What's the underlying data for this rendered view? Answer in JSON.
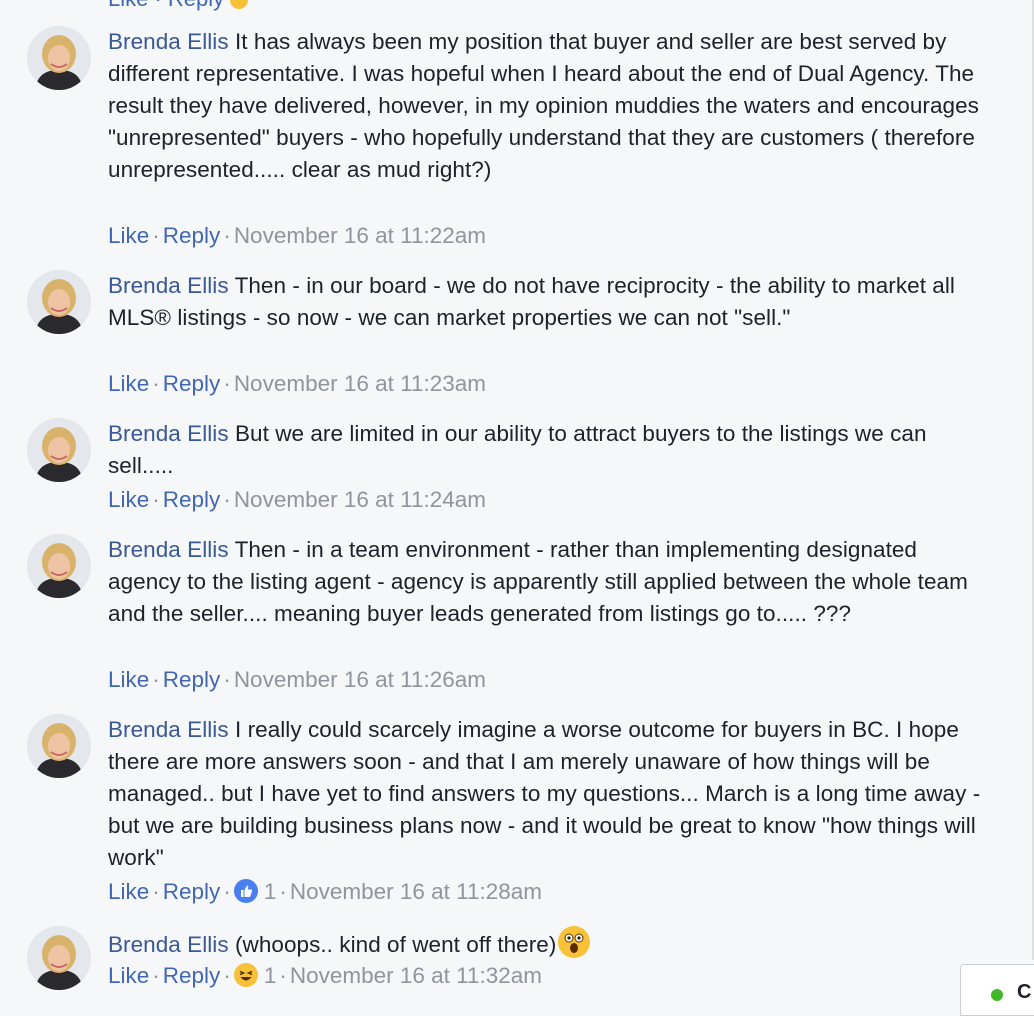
{
  "top_fragment": {
    "text": "Like · Reply"
  },
  "colors": {
    "link": "#4267b2",
    "author": "#385898",
    "meta": "#90949c",
    "text": "#1d2129",
    "background": "#f6f7f9",
    "online": "#42b72a"
  },
  "action_labels": {
    "like": "Like",
    "reply": "Reply",
    "separator": "·"
  },
  "comments": [
    {
      "author": "Brenda Ellis",
      "text": "It has always been my position that buyer and seller are best served by different representative. I was hopeful when I heard about the end of Dual Agency. The result they have delivered, however, in my opinion muddies the waters and encourages \"unrepresented\" buyers - who hopefully understand that they are customers ( therefore unrepresented..... clear as mud right?)",
      "timestamp": "November 16 at 11:22am"
    },
    {
      "author": "Brenda Ellis",
      "text": "Then - in our board - we do not have reciprocity - the ability to market all MLS® listings - so now - we can market properties we can not \"sell.\"",
      "timestamp": "November 16 at 11:23am"
    },
    {
      "author": "Brenda Ellis",
      "text": "But we are limited in our ability to attract buyers to the listings we can sell.....",
      "timestamp": "November 16 at 11:24am"
    },
    {
      "author": "Brenda Ellis",
      "text": "Then - in a team environment - rather than implementing designated agency to the listing agent - agency is apparently still applied between the whole team and the seller.... meaning buyer leads generated from listings go to..... ???",
      "timestamp": "November 16 at 11:26am"
    },
    {
      "author": "Brenda Ellis",
      "text": "I really could scarcely imagine a worse outcome for buyers in BC. I hope there are more answers soon - and that I am merely unaware of how things will be managed.. but I have yet to find answers to my questions... March is a long time away - but we are building business plans now - and it would be great to know \"how things will work\"",
      "reaction_icon": "like-reaction-icon",
      "reaction_count": "1",
      "timestamp": "November 16 at 11:28am"
    },
    {
      "author": "Brenda Ellis",
      "text": "(whoops.. kind of went off there)",
      "emoji": "wow-emoji-icon",
      "reaction_icon": "laughing-reaction-icon",
      "reaction_count": "1",
      "timestamp": "November 16 at 11:32am"
    }
  ],
  "chat": {
    "letter": "C",
    "status": "online"
  }
}
